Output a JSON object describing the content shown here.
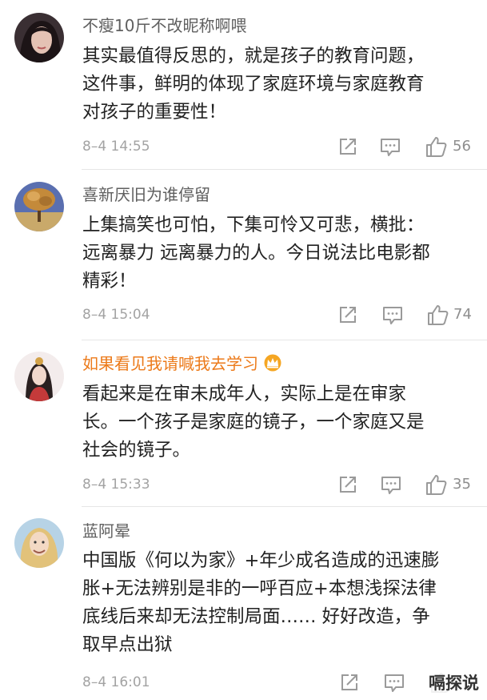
{
  "comments": [
    {
      "user": "不瘦10斤不改昵称啊喂",
      "vip": false,
      "lines": [
        "其实最值得反思的，就是孩子的教育问题，",
        "这件事，鲜明的体现了家庭环境与家庭教育",
        "对孩子的重要性！"
      ],
      "time": "8–4 14:55",
      "likes": "56"
    },
    {
      "user": "喜新厌旧为谁停留",
      "vip": false,
      "lines": [
        "上集搞笑也可怕，下集可怜又可悲，横批：",
        "远离暴力 远离暴力的人。今日说法比电影都",
        "精彩！"
      ],
      "time": "8–4 15:04",
      "likes": "74"
    },
    {
      "user": "如果看见我请喊我去学习",
      "vip": true,
      "lines": [
        "看起来是在审未成年人，实际上是在审家",
        "长。一个孩子是家庭的镜子，一个家庭又是",
        "社会的镜子。"
      ],
      "time": "8–4 15:33",
      "likes": "35"
    },
    {
      "user": "蓝阿晕",
      "vip": false,
      "lines": [
        "中国版《何以为家》+年少成名造成的迅速膨",
        "胀+无法辨别是非的一呼百应+本想浅探法律",
        "底线后来却无法控制局面…… 好好改造，争",
        "取早点出狱"
      ],
      "time": "8–4 16:01",
      "likes": ""
    }
  ],
  "icons": {
    "share": "share-icon",
    "reply": "comment-icon",
    "like": "thumbs-up-icon",
    "vip": "crown-icon"
  },
  "colors": {
    "username": "#5f5f5f",
    "vip_username": "#ec7a1a",
    "text": "#222222",
    "meta": "#a3a3a3"
  },
  "watermark": "嗝探说"
}
